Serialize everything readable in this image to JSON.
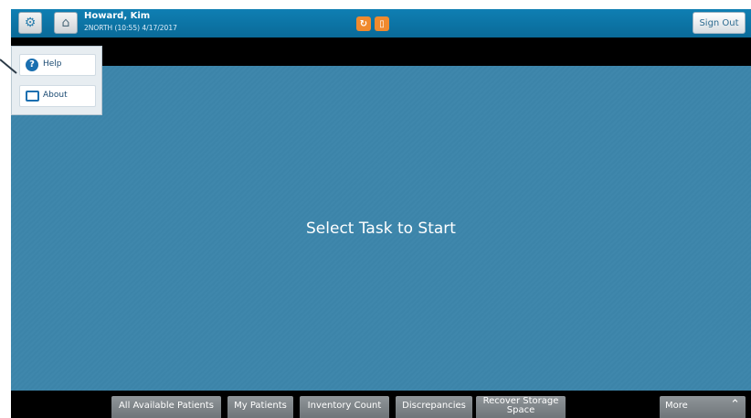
{
  "header": {
    "user_name": "Howard, Kim",
    "location_time": "2NORTH (10:55) 4/17/2017",
    "sign_out_label": "Sign Out",
    "icons": [
      "gear-icon",
      "home-icon",
      "tasks-icon",
      "alerts-icon"
    ]
  },
  "menu": {
    "items": [
      {
        "label": "Help",
        "icon": "help-icon"
      },
      {
        "label": "About",
        "icon": "about-icon"
      }
    ]
  },
  "main": {
    "message": "Select Task to Start"
  },
  "tabs": [
    {
      "label": "All Available Patients"
    },
    {
      "label": "My Patients"
    },
    {
      "label": "Inventory Count"
    },
    {
      "label": "Discrepancies"
    },
    {
      "label": "Recover Storage Space"
    },
    {
      "label": "More"
    }
  ],
  "colors": {
    "topbar": "#0f7fb3",
    "main_bg": "#3c84a9",
    "accent_orange": "#f08a2e",
    "tab_bg": "#7f8589"
  }
}
